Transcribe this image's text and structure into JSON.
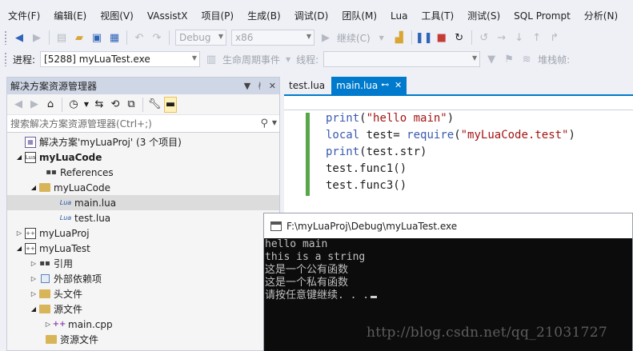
{
  "menubar": {
    "items": [
      "文件(F)",
      "编辑(E)",
      "视图(V)",
      "VAssistX",
      "项目(P)",
      "生成(B)",
      "调试(D)",
      "团队(M)",
      "Lua",
      "工具(T)",
      "测试(S)",
      "SQL Prompt",
      "分析(N)"
    ]
  },
  "toolbar": {
    "config": "Debug",
    "platform": "x86",
    "continue_label": "继续(C)",
    "process_label": "进程:",
    "process_value": "[5288] myLuaTest.exe",
    "lifecycle_label": "生命周期事件",
    "thread_label": "线程:",
    "stackframe_label": "堆栈帧:"
  },
  "solution_explorer": {
    "title": "解决方案资源管理器",
    "search_placeholder": "搜索解决方案资源管理器(Ctrl+;)",
    "tree": [
      {
        "label": "解决方案'myLuaProj' (3 个项目)",
        "icon": "solution-icon",
        "expander": "",
        "bold": false,
        "selected": false
      },
      {
        "label": "myLuaCode",
        "icon": "lua-project-icon",
        "expander": "◢",
        "bold": true,
        "selected": false
      },
      {
        "label": "References",
        "icon": "references-icon",
        "expander": "",
        "bold": false,
        "selected": false
      },
      {
        "label": "myLuaCode",
        "icon": "folder-icon",
        "expander": "◢",
        "bold": false,
        "selected": false
      },
      {
        "label": "main.lua",
        "icon": "lua-file-icon",
        "expander": "",
        "bold": false,
        "selected": true
      },
      {
        "label": "test.lua",
        "icon": "lua-file-icon",
        "expander": "",
        "bold": false,
        "selected": false
      },
      {
        "label": "myLuaProj",
        "icon": "cpp-project-icon",
        "expander": "▷",
        "bold": false,
        "selected": false
      },
      {
        "label": "myLuaTest",
        "icon": "cpp-project-icon",
        "expander": "◢",
        "bold": false,
        "selected": false
      },
      {
        "label": "引用",
        "icon": "references-icon",
        "expander": "▷",
        "bold": false,
        "selected": false
      },
      {
        "label": "外部依赖项",
        "icon": "external-dependencies-icon",
        "expander": "▷",
        "bold": false,
        "selected": false
      },
      {
        "label": "头文件",
        "icon": "folder-icon",
        "expander": "▷",
        "bold": false,
        "selected": false
      },
      {
        "label": "源文件",
        "icon": "folder-icon",
        "expander": "◢",
        "bold": false,
        "selected": false
      },
      {
        "label": "main.cpp",
        "icon": "cpp-file-icon",
        "expander": "▷",
        "bold": false,
        "selected": false
      },
      {
        "label": "资源文件",
        "icon": "folder-icon",
        "expander": "",
        "bold": false,
        "selected": false
      }
    ]
  },
  "editor": {
    "tabs": [
      {
        "label": "test.lua",
        "active": false
      },
      {
        "label": "main.lua",
        "active": true
      }
    ],
    "code": [
      "print(\"hello main\")",
      "local test= require(\"myLuaCode.test\")",
      "print(test.str)",
      "test.func1()",
      "test.func3()"
    ]
  },
  "console": {
    "title": "F:\\myLuaProj\\Debug\\myLuaTest.exe",
    "lines": [
      "hello main",
      "this is a string",
      "这是一个公有函数",
      "这是一个私有函数",
      "请按任意键继续. . ."
    ],
    "watermark": "http://blog.csdn.net/qq_21031727"
  },
  "colors": {
    "accent": "#007acc",
    "change_bar": "#57a64a",
    "keyword": "#3a5bb0",
    "string": "#a31515",
    "console_bg": "#0c0c0c"
  }
}
